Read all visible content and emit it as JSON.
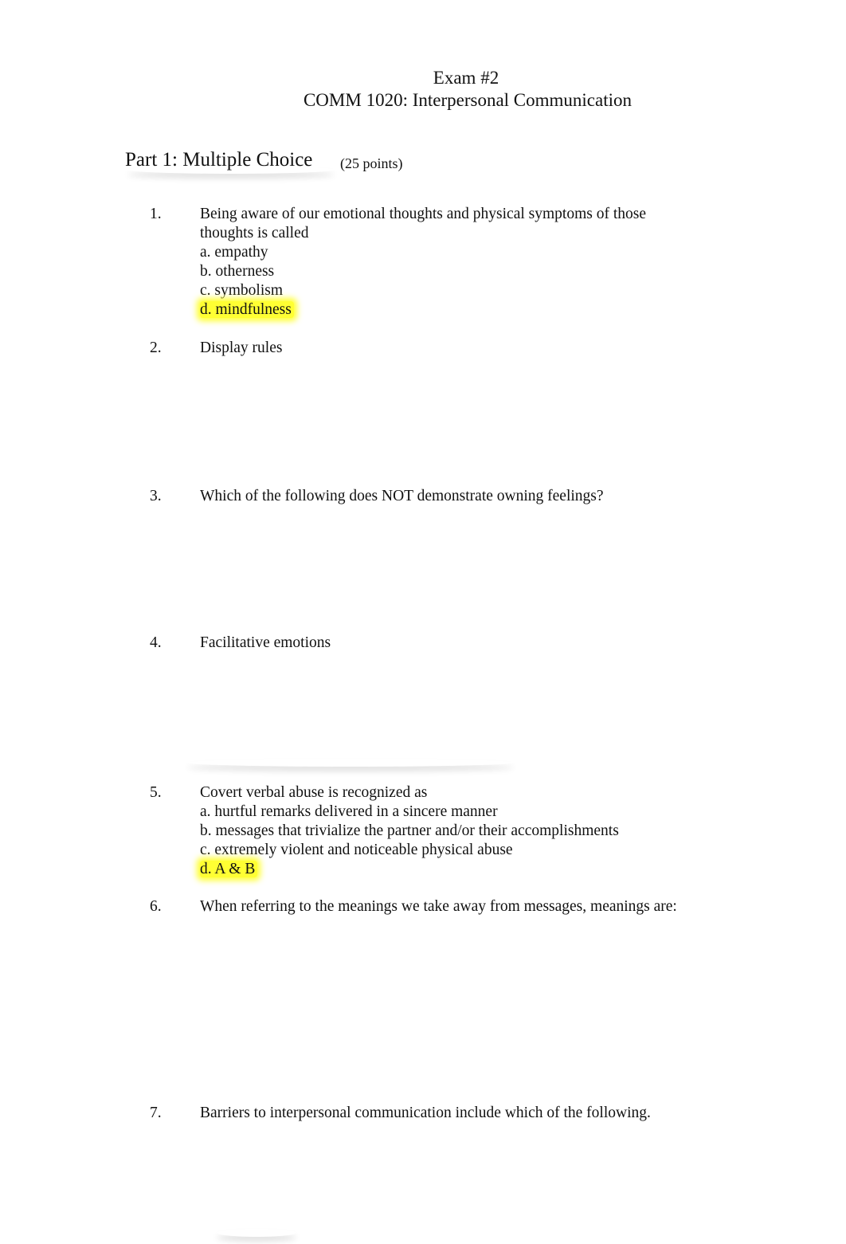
{
  "header": {
    "title": "Exam #2",
    "subtitle": "COMM 1020: Interpersonal Communication"
  },
  "part": {
    "heading": "Part 1: Multiple Choice",
    "points": "(25 points)"
  },
  "questions": [
    {
      "number": "1.",
      "lines": [
        "Being aware of our emotional thoughts and physical symptoms of those",
        "thoughts is called"
      ],
      "options": [
        "a. empathy",
        "b. otherness",
        "c. symbolism",
        "d. mindfulness"
      ],
      "highlighted_option": "d. mindfulness"
    },
    {
      "number": "2.",
      "lines": [
        "Display rules"
      ],
      "options": []
    },
    {
      "number": "3.",
      "lines": [
        "Which of the following does NOT demonstrate owning feelings?"
      ],
      "options": []
    },
    {
      "number": "4.",
      "lines": [
        "Facilitative emotions"
      ],
      "options": []
    },
    {
      "number": "5.",
      "lines": [
        "Covert verbal abuse is recognized as"
      ],
      "options": [
        "a. hurtful remarks delivered in a sincere manner",
        "b. messages that trivialize the partner and/or their accomplishments",
        "c. extremely violent and noticeable physical abuse",
        "d. A & B"
      ],
      "highlighted_option": "d. A & B"
    },
    {
      "number": "6.",
      "lines": [
        "When referring to the meanings we take away from messages, meanings are:"
      ],
      "options": []
    },
    {
      "number": "7.",
      "lines": [
        "Barriers to interpersonal communication include which of the following."
      ],
      "options": []
    }
  ],
  "colors": {
    "highlight": "#ffff33",
    "text": "#111111"
  }
}
